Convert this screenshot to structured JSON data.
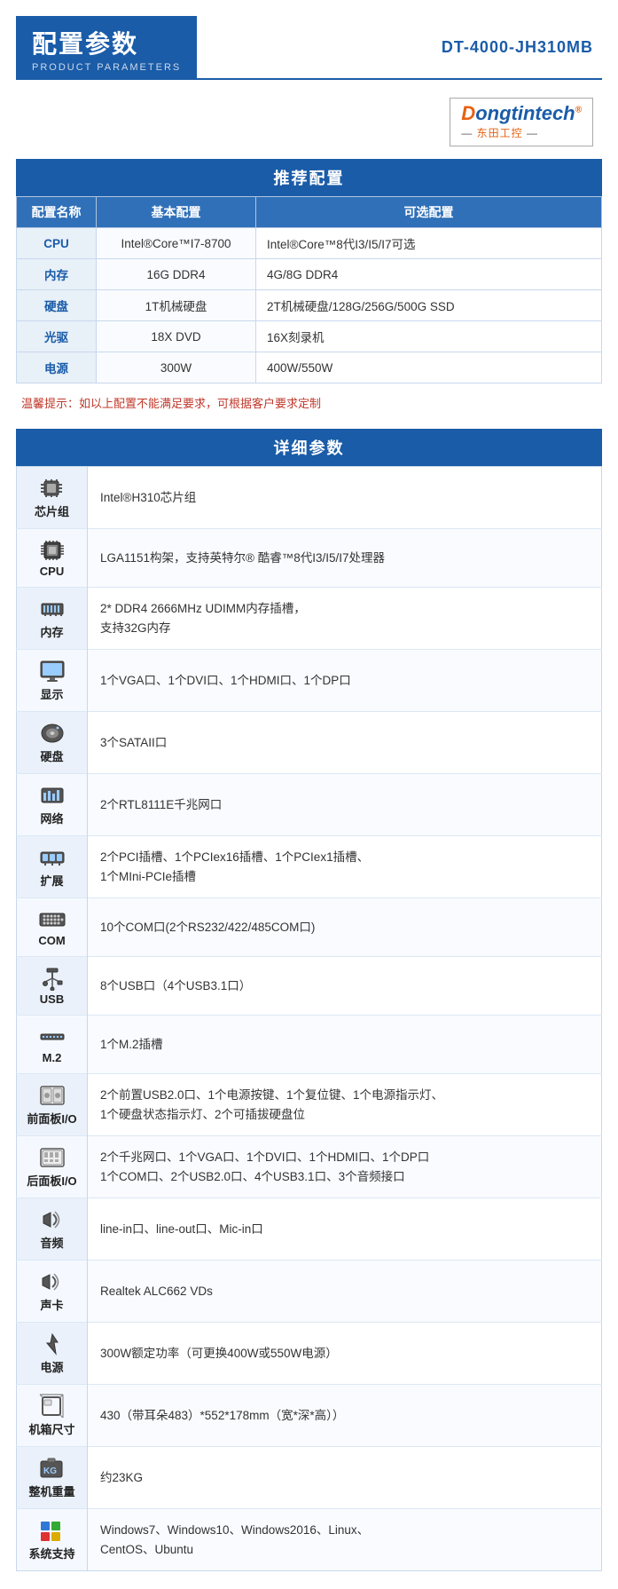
{
  "header": {
    "title": "配置参数",
    "subtitle": "PRODUCT PARAMETERS",
    "model": "DT-4000-JH310MB"
  },
  "logo": {
    "brand": "Dongtintech",
    "brand_prefix": "D",
    "brand_suffix": "ongtintech",
    "reg_mark": "®",
    "sub_line1": "— 东田工控 —"
  },
  "recommend": {
    "section_title": "推荐配置",
    "col_name": "配置名称",
    "col_basic": "基本配置",
    "col_optional": "可选配置",
    "rows": [
      {
        "name": "CPU",
        "basic": "Intel®Core™I7-8700",
        "optional": "Intel®Core™8代I3/I5/I7可选"
      },
      {
        "name": "内存",
        "basic": "16G DDR4",
        "optional": "4G/8G DDR4"
      },
      {
        "name": "硬盘",
        "basic": "1T机械硬盘",
        "optional": "2T机械硬盘/128G/256G/500G SSD"
      },
      {
        "name": "光驱",
        "basic": "18X DVD",
        "optional": "16X刻录机"
      },
      {
        "name": "电源",
        "basic": "300W",
        "optional": "400W/550W"
      }
    ],
    "warm_tip": "温馨提示：如以上配置不能满足要求，可根据客户要求定制"
  },
  "detail": {
    "section_title": "详细参数",
    "rows": [
      {
        "icon": "chipset",
        "label": "芯片组",
        "value": "Intel®H310芯片组"
      },
      {
        "icon": "cpu",
        "label": "CPU",
        "value": "LGA1151构架，支持英特尔® 酷睿™8代I3/I5/I7处理器"
      },
      {
        "icon": "memory",
        "label": "内存",
        "value": "2* DDR4 2666MHz UDIMM内存插槽，\n支持32G内存"
      },
      {
        "icon": "display",
        "label": "显示",
        "value": "1个VGA口、1个DVI口、1个HDMI口、1个DP口"
      },
      {
        "icon": "hdd",
        "label": "硬盘",
        "value": "3个SATAII口"
      },
      {
        "icon": "network",
        "label": "网络",
        "value": "2个RTL8111E千兆网口"
      },
      {
        "icon": "expand",
        "label": "扩展",
        "value": "2个PCI插槽、1个PCIex16插槽、1个PCIex1插槽、\n1个MIni-PCIe插槽"
      },
      {
        "icon": "com",
        "label": "COM",
        "value": "10个COM口(2个RS232/422/485COM口)"
      },
      {
        "icon": "usb",
        "label": "USB",
        "value": "8个USB口（4个USB3.1口）"
      },
      {
        "icon": "m2",
        "label": "M.2",
        "value": "1个M.2插槽"
      },
      {
        "icon": "front-panel",
        "label": "前面板I/O",
        "value": "2个前置USB2.0口、1个电源按键、1个复位键、1个电源指示灯、\n1个硬盘状态指示灯、2个可插拔硬盘位"
      },
      {
        "icon": "rear-panel",
        "label": "后面板I/O",
        "value": "2个千兆网口、1个VGA口、1个DVI口、1个HDMI口、1个DP口\n1个COM口、2个USB2.0口、4个USB3.1口、3个音频接口"
      },
      {
        "icon": "audio",
        "label": "音频",
        "value": "line-in口、line-out口、Mic-in口"
      },
      {
        "icon": "soundcard",
        "label": "声卡",
        "value": "Realtek ALC662 VDs"
      },
      {
        "icon": "power",
        "label": "电源",
        "value": "300W额定功率（可更换400W或550W电源）"
      },
      {
        "icon": "chassis",
        "label": "机箱尺寸",
        "value": "430（带耳朵483）*552*178mm（宽*深*高））"
      },
      {
        "icon": "weight",
        "label": "整机重量",
        "value": "约23KG"
      },
      {
        "icon": "os",
        "label": "系统支持",
        "value": "Windows7、Windows10、Windows2016、Linux、\nCentOS、Ubuntu"
      }
    ]
  }
}
